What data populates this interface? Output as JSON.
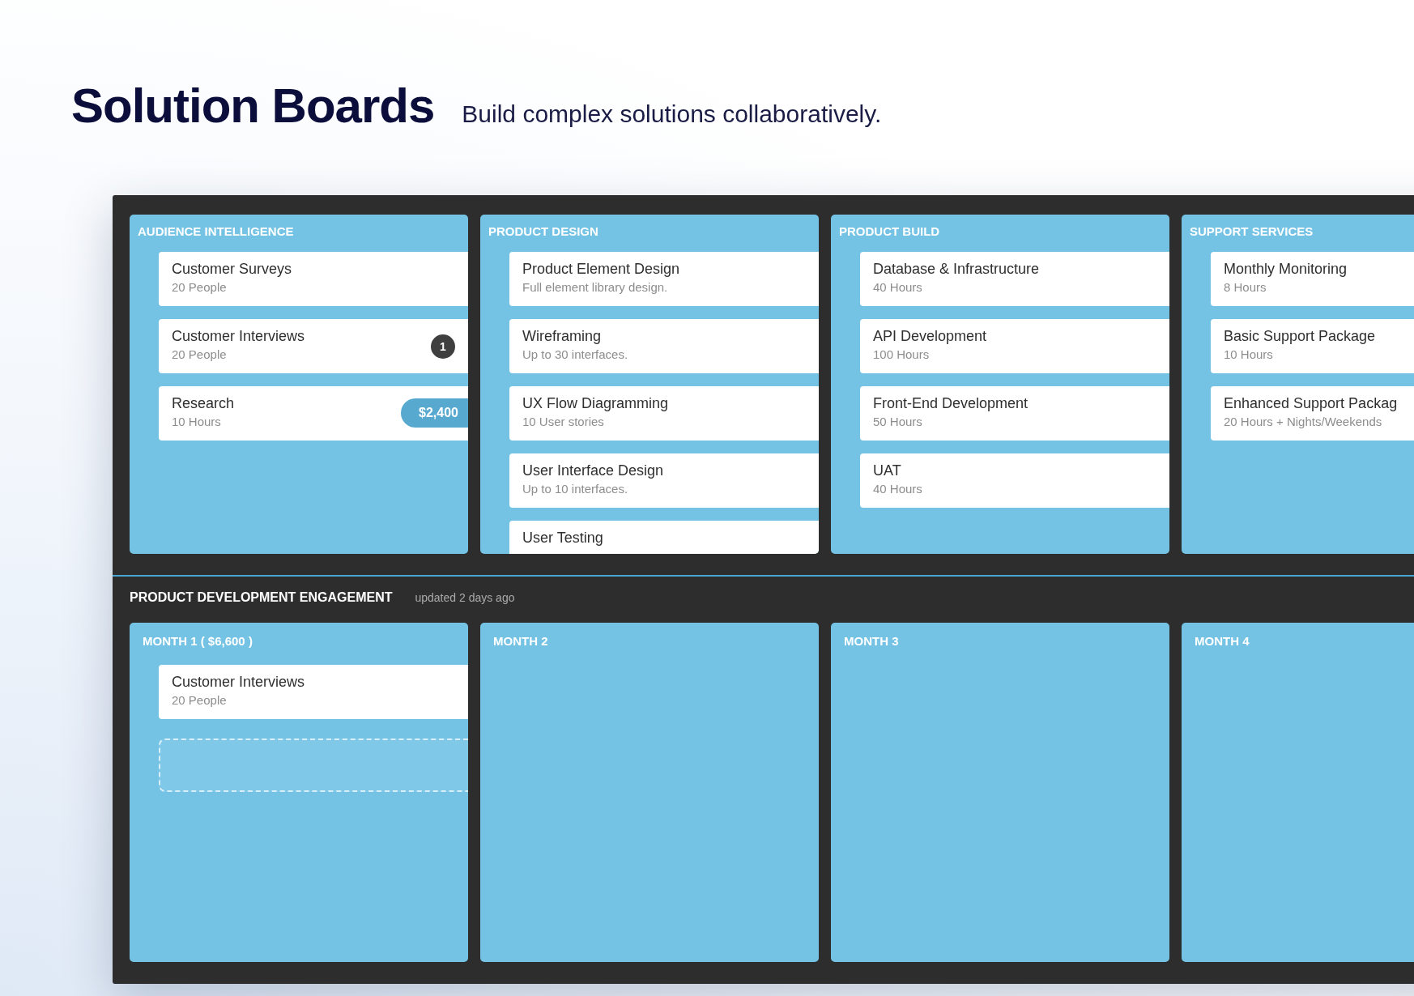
{
  "header": {
    "title": "Solution Boards",
    "subtitle": "Build complex solutions collaboratively."
  },
  "categories": [
    {
      "title": "AUDIENCE INTELLIGENCE",
      "cards": [
        {
          "title": "Customer Surveys",
          "detail": "20 People"
        },
        {
          "title": "Customer Interviews",
          "detail": "20 People",
          "badge": {
            "kind": "count",
            "text": "1"
          }
        },
        {
          "title": "Research",
          "detail": "10 Hours",
          "badge": {
            "kind": "price",
            "text": "$2,400"
          }
        }
      ]
    },
    {
      "title": "PRODUCT DESIGN",
      "cards": [
        {
          "title": "Product Element Design",
          "detail": "Full element library design."
        },
        {
          "title": "Wireframing",
          "detail": "Up to 30 interfaces."
        },
        {
          "title": "UX Flow Diagramming",
          "detail": "10 User stories"
        },
        {
          "title": "User Interface Design",
          "detail": "Up to 10 interfaces."
        },
        {
          "title": "User Testing"
        }
      ]
    },
    {
      "title": "PRODUCT BUILD",
      "cards": [
        {
          "title": "Database & Infrastructure",
          "detail": "40 Hours"
        },
        {
          "title": "API Development",
          "detail": "100 Hours"
        },
        {
          "title": "Front-End Development",
          "detail": "50 Hours"
        },
        {
          "title": "UAT",
          "detail": "40 Hours"
        }
      ]
    },
    {
      "title": "SUPPORT SERVICES",
      "cards": [
        {
          "title": "Monthly Monitoring",
          "detail": "8 Hours"
        },
        {
          "title": "Basic Support Package",
          "detail": "10 Hours"
        },
        {
          "title": "Enhanced Support Packag",
          "detail": "20 Hours + Nights/Weekends"
        }
      ]
    }
  ],
  "engagement": {
    "title": "PRODUCT DEVELOPMENT ENGAGEMENT",
    "updated": "updated 2 days ago",
    "months": [
      {
        "title": "MONTH 1  ( $6,600 )",
        "cards": [
          {
            "title": "Customer Interviews",
            "detail": "20 People"
          }
        ],
        "drop_zone": true
      },
      {
        "title": "MONTH 2",
        "drop_zone": false
      },
      {
        "title": "MONTH 3",
        "drop_zone": false
      },
      {
        "title": "MONTH 4",
        "drop_zone": false
      }
    ]
  }
}
